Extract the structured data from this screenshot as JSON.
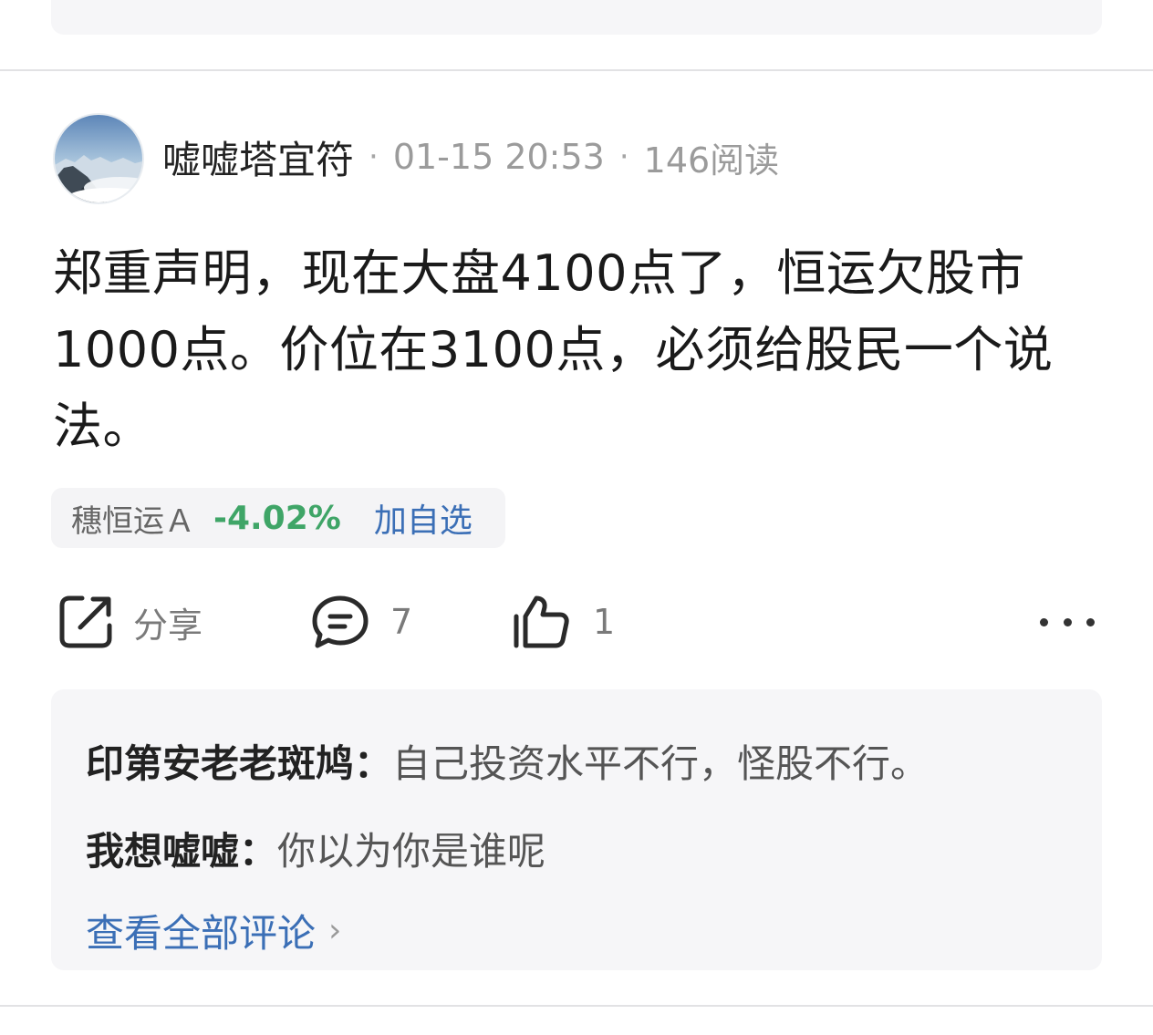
{
  "post": {
    "author": "嘘嘘塔宜符",
    "separator": "·",
    "time": "01-15 20:53",
    "reads": "146阅读",
    "content": "郑重声明，现在大盘4100点了，恒运欠股市1000点。价位在3100点，必须给股民一个说法。"
  },
  "stock": {
    "name": "穗恒运Ａ",
    "change": "-4.02%",
    "add_label": "加自选",
    "change_color": "#3fa567"
  },
  "actions": {
    "share_label": "分享",
    "comment_count": "7",
    "like_count": "1",
    "share_icon": "share-icon",
    "comment_icon": "comment-icon",
    "like_icon": "thumbs-up-icon",
    "more_icon": "more-icon"
  },
  "comments": {
    "items": [
      {
        "user": "印第安老老斑鸠：",
        "text": "自己投资水平不行，怪股不行。"
      },
      {
        "user": "我想嘘嘘：",
        "text": "你以为你是谁呢"
      }
    ],
    "view_all": "查看全部评论",
    "view_all_arrow": "›"
  },
  "colors": {
    "link": "#3b6fb6",
    "positive_change": "#3fa567",
    "panel_bg": "#f6f6f8"
  }
}
